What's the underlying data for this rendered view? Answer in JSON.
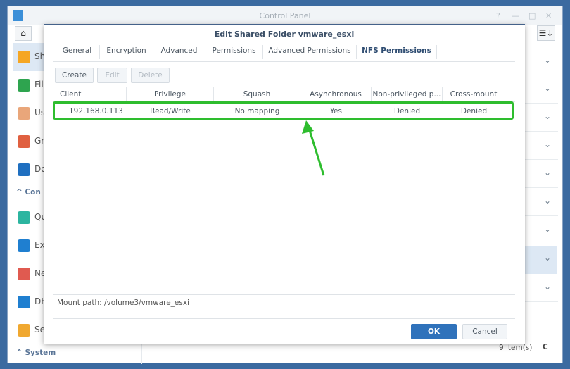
{
  "window": {
    "title": "Control Panel",
    "help": "?",
    "minimize": "—",
    "maximize": "□",
    "close": "✕",
    "home_icon": "⌂",
    "sort_icon": "☰↓",
    "item_count": "9 item(s)",
    "refresh_icon": "C"
  },
  "sidebar": {
    "items": [
      {
        "label": "Sh",
        "color": "#f5a623"
      },
      {
        "label": "Fil",
        "color": "#2ea44f"
      },
      {
        "label": "Us",
        "color": "#e9a67a"
      },
      {
        "label": "Gr",
        "color": "#e06040"
      },
      {
        "label": "Do",
        "color": "#1f6fc0"
      }
    ],
    "section_connectivity": "Con",
    "items2": [
      {
        "label": "Qu",
        "color": "#2cb5a0"
      },
      {
        "label": "Ex",
        "color": "#1f7fd0"
      },
      {
        "label": "Ne",
        "color": "#e05a50"
      },
      {
        "label": "DH",
        "color": "#1f7fd0"
      },
      {
        "label": "Se",
        "color": "#f0a830"
      }
    ],
    "section_system": "System"
  },
  "dialog": {
    "title": "Edit Shared Folder vmware_esxi",
    "tabs": [
      "General",
      "Encryption",
      "Advanced",
      "Permissions",
      "Advanced Permissions",
      "NFS Permissions"
    ],
    "buttons": {
      "create": "Create",
      "edit": "Edit",
      "delete": "Delete"
    },
    "columns": [
      "Client",
      "Privilege",
      "Squash",
      "Asynchronous",
      "Non-privileged p...",
      "Cross-mount"
    ],
    "rows": [
      [
        "192.168.0.113",
        "Read/Write",
        "No mapping",
        "Yes",
        "Denied",
        "Denied"
      ]
    ],
    "mount_path": "Mount path: /volume3/vmware_esxi",
    "ok": "OK",
    "cancel": "Cancel"
  },
  "colors": {
    "highlight": "#2ebd2e",
    "primary": "#2f72bb"
  }
}
